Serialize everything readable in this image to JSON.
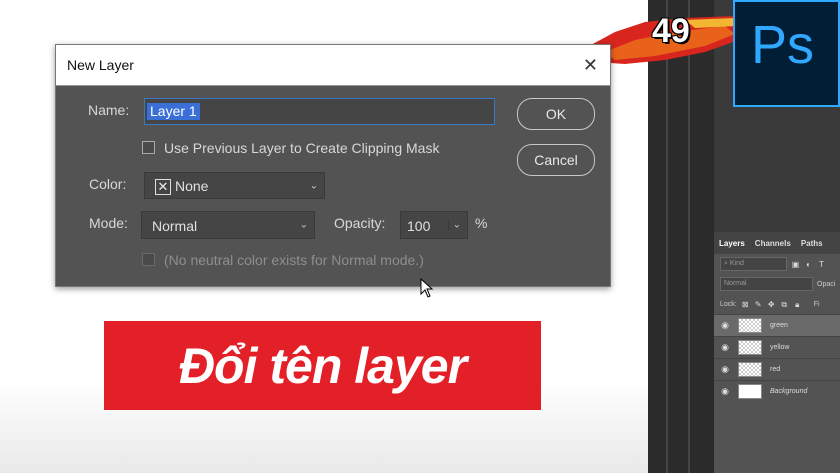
{
  "dialog": {
    "title": "New Layer",
    "close_glyph": "✕",
    "name_label": "Name:",
    "name_value": "Layer 1",
    "clip_label": "Use Previous Layer to Create Clipping Mask",
    "color_label": "Color:",
    "color_value": "None",
    "mode_label": "Mode:",
    "mode_value": "Normal",
    "opacity_label": "Opacity:",
    "opacity_value": "100",
    "opacity_unit": "%",
    "neutral_label": "(No neutral color exists for Normal mode.)",
    "ok_label": "OK",
    "cancel_label": "Cancel"
  },
  "banner": {
    "text": "Đổi tên layer"
  },
  "episode": {
    "number": "49"
  },
  "ps_logo": {
    "text": "Ps"
  },
  "layers_panel": {
    "tabs": [
      "Layers",
      "Channels",
      "Paths"
    ],
    "kind_placeholder": "Kind",
    "blend_value": "Normal",
    "opacity_label": "Opaci",
    "lock_label": "Lock:",
    "fill_label": "Fi",
    "layers": [
      {
        "name": "green",
        "selected": true,
        "italic": false
      },
      {
        "name": "yellow",
        "selected": false,
        "italic": false
      },
      {
        "name": "red",
        "selected": false,
        "italic": false
      },
      {
        "name": "Background",
        "selected": false,
        "italic": true
      }
    ]
  },
  "colors": {
    "banner_red": "#e32027",
    "ps_blue": "#31a8ff",
    "ps_bg": "#001e36",
    "dialog_bg": "#535353"
  }
}
